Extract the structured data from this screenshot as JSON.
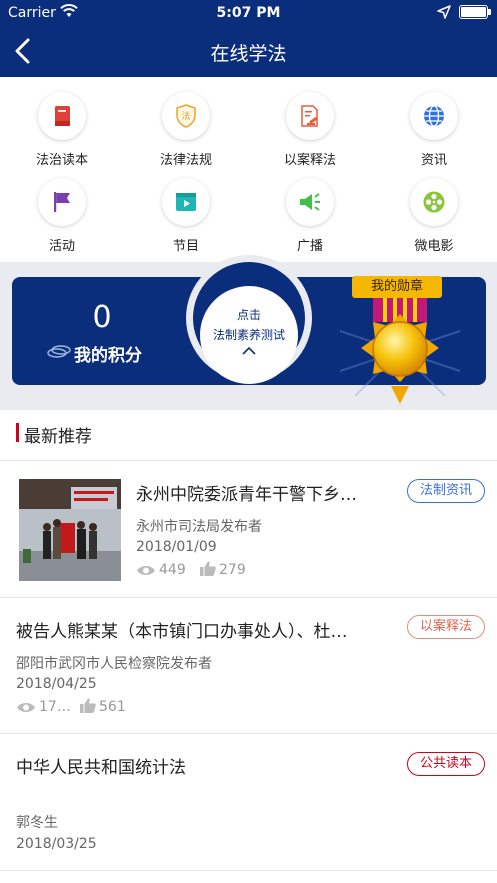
{
  "status_bar": {
    "carrier": "Carrier",
    "time": "5:07 PM"
  },
  "nav": {
    "title": "在线学法",
    "back_icon": "chevron-left-icon"
  },
  "grid": [
    {
      "label": "法治读本",
      "icon": "book-icon",
      "color": "#e0403a"
    },
    {
      "label": "法律法规",
      "icon": "shield-law-icon",
      "color": "#f0a020"
    },
    {
      "label": "以案释法",
      "icon": "gavel-document-icon",
      "color": "#e85a3a"
    },
    {
      "label": "资讯",
      "icon": "globe-icon",
      "color": "#2f6fe0"
    },
    {
      "label": "活动",
      "icon": "flag-icon",
      "color": "#7b3fb0"
    },
    {
      "label": "节目",
      "icon": "play-box-icon",
      "color": "#1fb5b5"
    },
    {
      "label": "广播",
      "icon": "megaphone-icon",
      "color": "#3fc04a"
    },
    {
      "label": "微电影",
      "icon": "film-reel-icon",
      "color": "#8cc43a"
    }
  ],
  "banner": {
    "score_value": "0",
    "score_label": "我的积分",
    "test_line1": "点击",
    "test_line2": "法制素养测试",
    "medal_label": "我的勋章",
    "primary_color": "#0b2e7c"
  },
  "section": {
    "title": "最新推荐"
  },
  "feed": [
    {
      "title": "永州中院委派青年干警下乡…",
      "publisher": "永州市司法局发布者",
      "date": "2018/01/09",
      "views": "449",
      "likes": "279",
      "tag": "法制资讯"
    },
    {
      "title": "被告人熊某某（本市镇门口办事处人）、杜…",
      "publisher": "邵阳市武冈市人民检察院发布者",
      "date": "2018/04/25",
      "views": "17…",
      "likes": "561",
      "tag": "以案释法"
    },
    {
      "title": "中华人民共和国统计法",
      "publisher": "郭冬生",
      "date": "2018/03/25",
      "tag": "公共读本"
    }
  ]
}
